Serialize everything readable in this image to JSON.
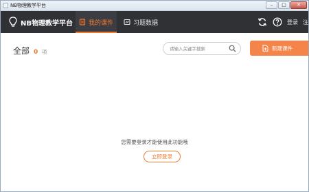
{
  "window": {
    "title": "NB物理教学平台",
    "controls": {
      "minimize": "–",
      "maximize": "□",
      "close": "✕"
    }
  },
  "header": {
    "app_name": "NB物理教学平台",
    "tabs": [
      {
        "label": "我的课件",
        "icon": "courseware-icon",
        "active": true
      },
      {
        "label": "习题数据",
        "icon": "exercise-data-icon",
        "active": false
      }
    ],
    "actions": {
      "login": "登录",
      "register": "注"
    }
  },
  "main": {
    "heading": "全部",
    "count": "0",
    "count_unit": "项",
    "search_placeholder": "请输入关键字搜索",
    "new_button": "新建课件",
    "empty_message": "您需要登录才能使用此功能哦",
    "login_button": "立即登录"
  },
  "colors": {
    "accent": "#f07a2f",
    "header_bg": "#2f3135",
    "button_bg": "#f5844a"
  }
}
